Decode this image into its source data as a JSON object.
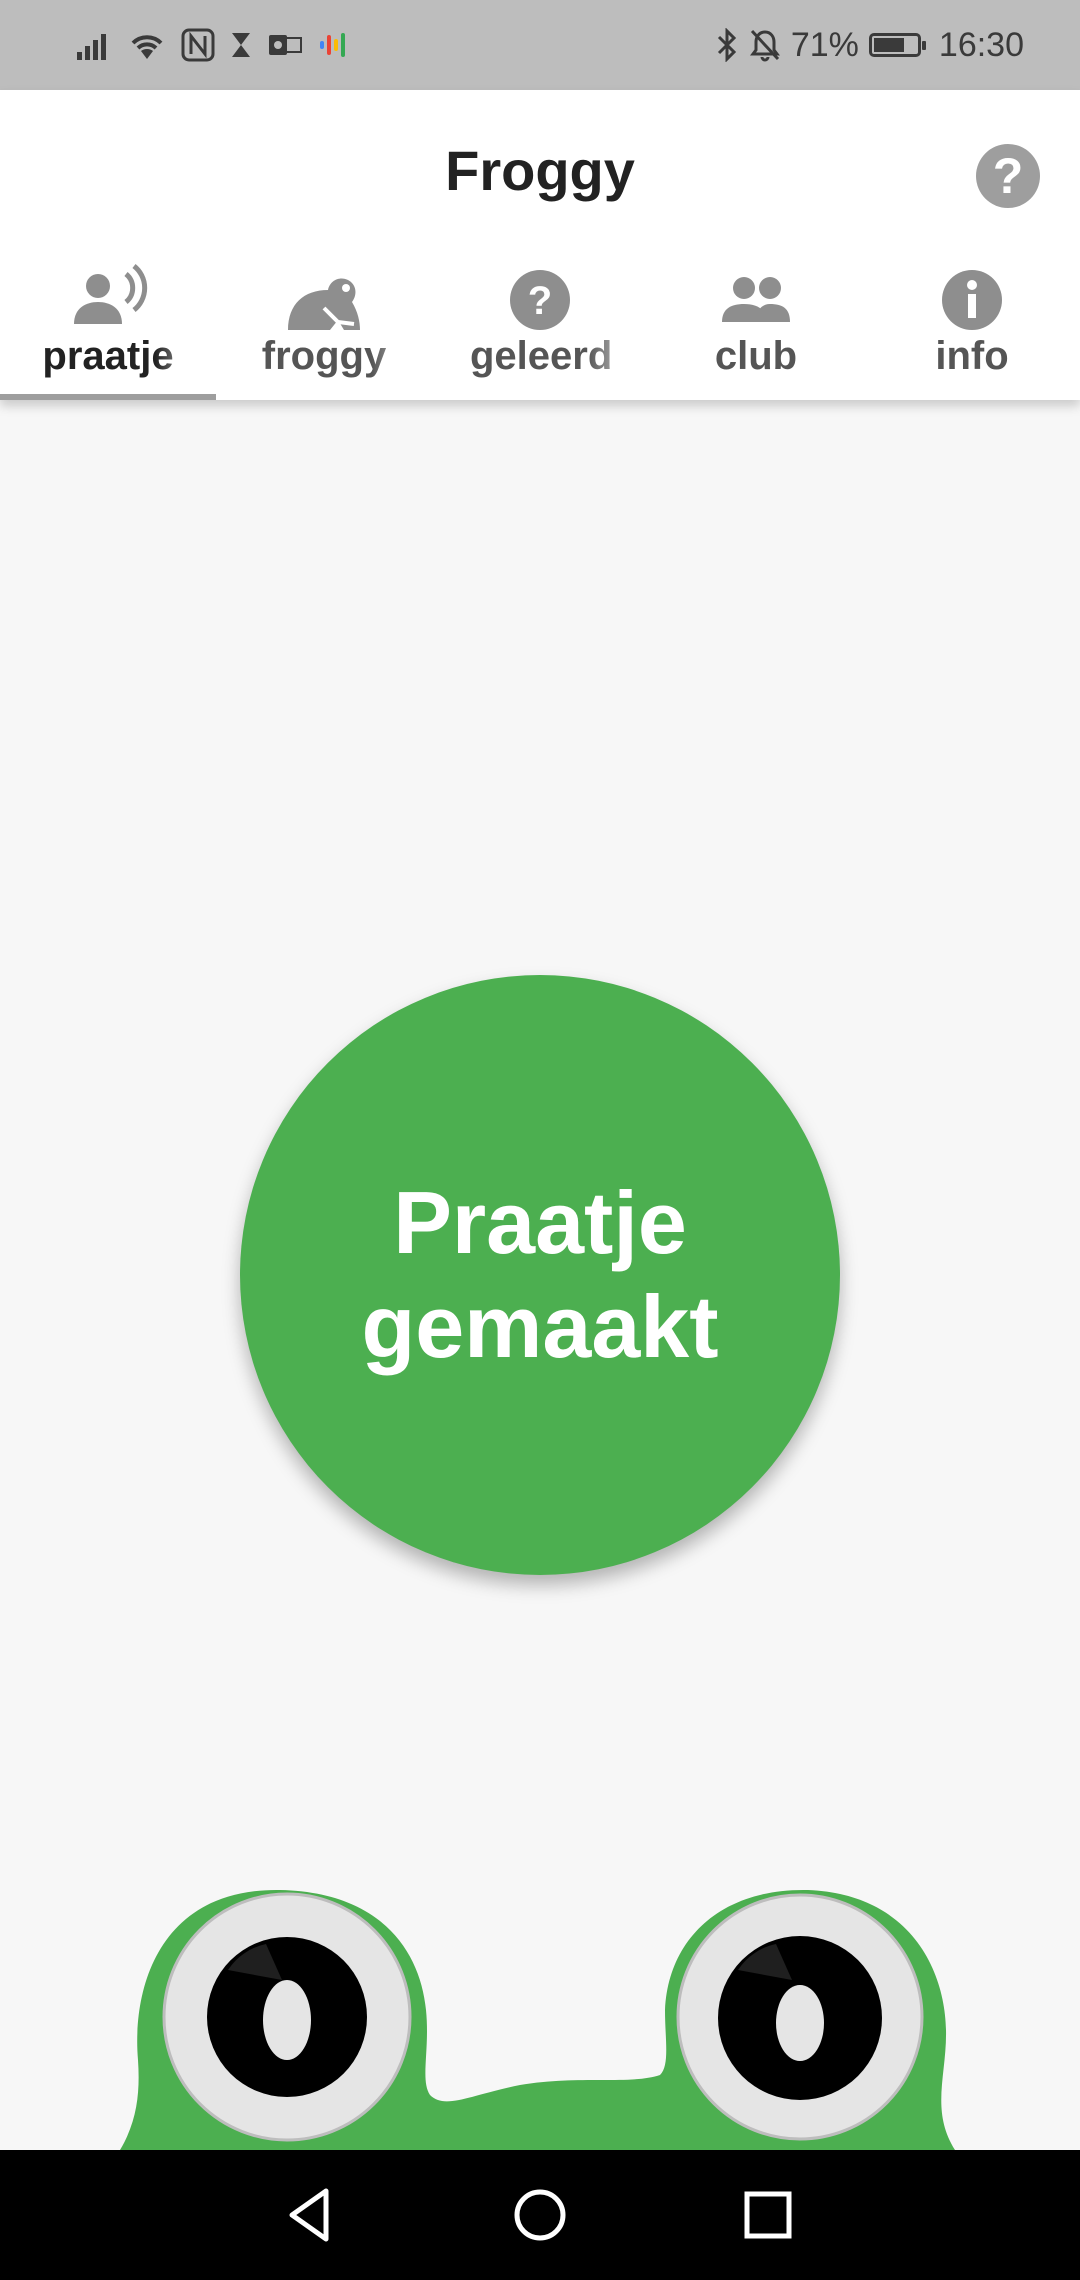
{
  "status_bar": {
    "battery_percent": "71%",
    "battery_level": 0.71,
    "time": "16:30",
    "left_icons": [
      "signal-icon",
      "wifi-icon",
      "nfc-icon",
      "hourglass-icon",
      "outlook-icon",
      "podcast-icon"
    ],
    "right_icons": [
      "bluetooth-icon",
      "bell-off-icon",
      "battery-icon"
    ]
  },
  "app_bar": {
    "title": "Froggy",
    "help_icon": "help-circle-icon"
  },
  "tabs": [
    {
      "label": "praatje",
      "icon": "speaking-person-icon",
      "active": true
    },
    {
      "label": "froggy",
      "icon": "frog-icon",
      "active": false
    },
    {
      "label": "geleerd",
      "icon": "help-circle-icon",
      "active": false
    },
    {
      "label": "club",
      "icon": "people-icon",
      "active": false
    },
    {
      "label": "info",
      "icon": "info-circle-icon",
      "active": false
    }
  ],
  "main": {
    "button_line1": "Praatje",
    "button_line2": "gemaakt"
  },
  "colors": {
    "accent_green": "#4caf50",
    "status_bar": "#bdbdbd",
    "app_bar": "#ffffff",
    "background": "#f7f7f7",
    "icon_grey": "#9e9e9e"
  },
  "nav_bar": {
    "buttons": [
      "back-icon",
      "home-icon",
      "recents-icon"
    ]
  }
}
